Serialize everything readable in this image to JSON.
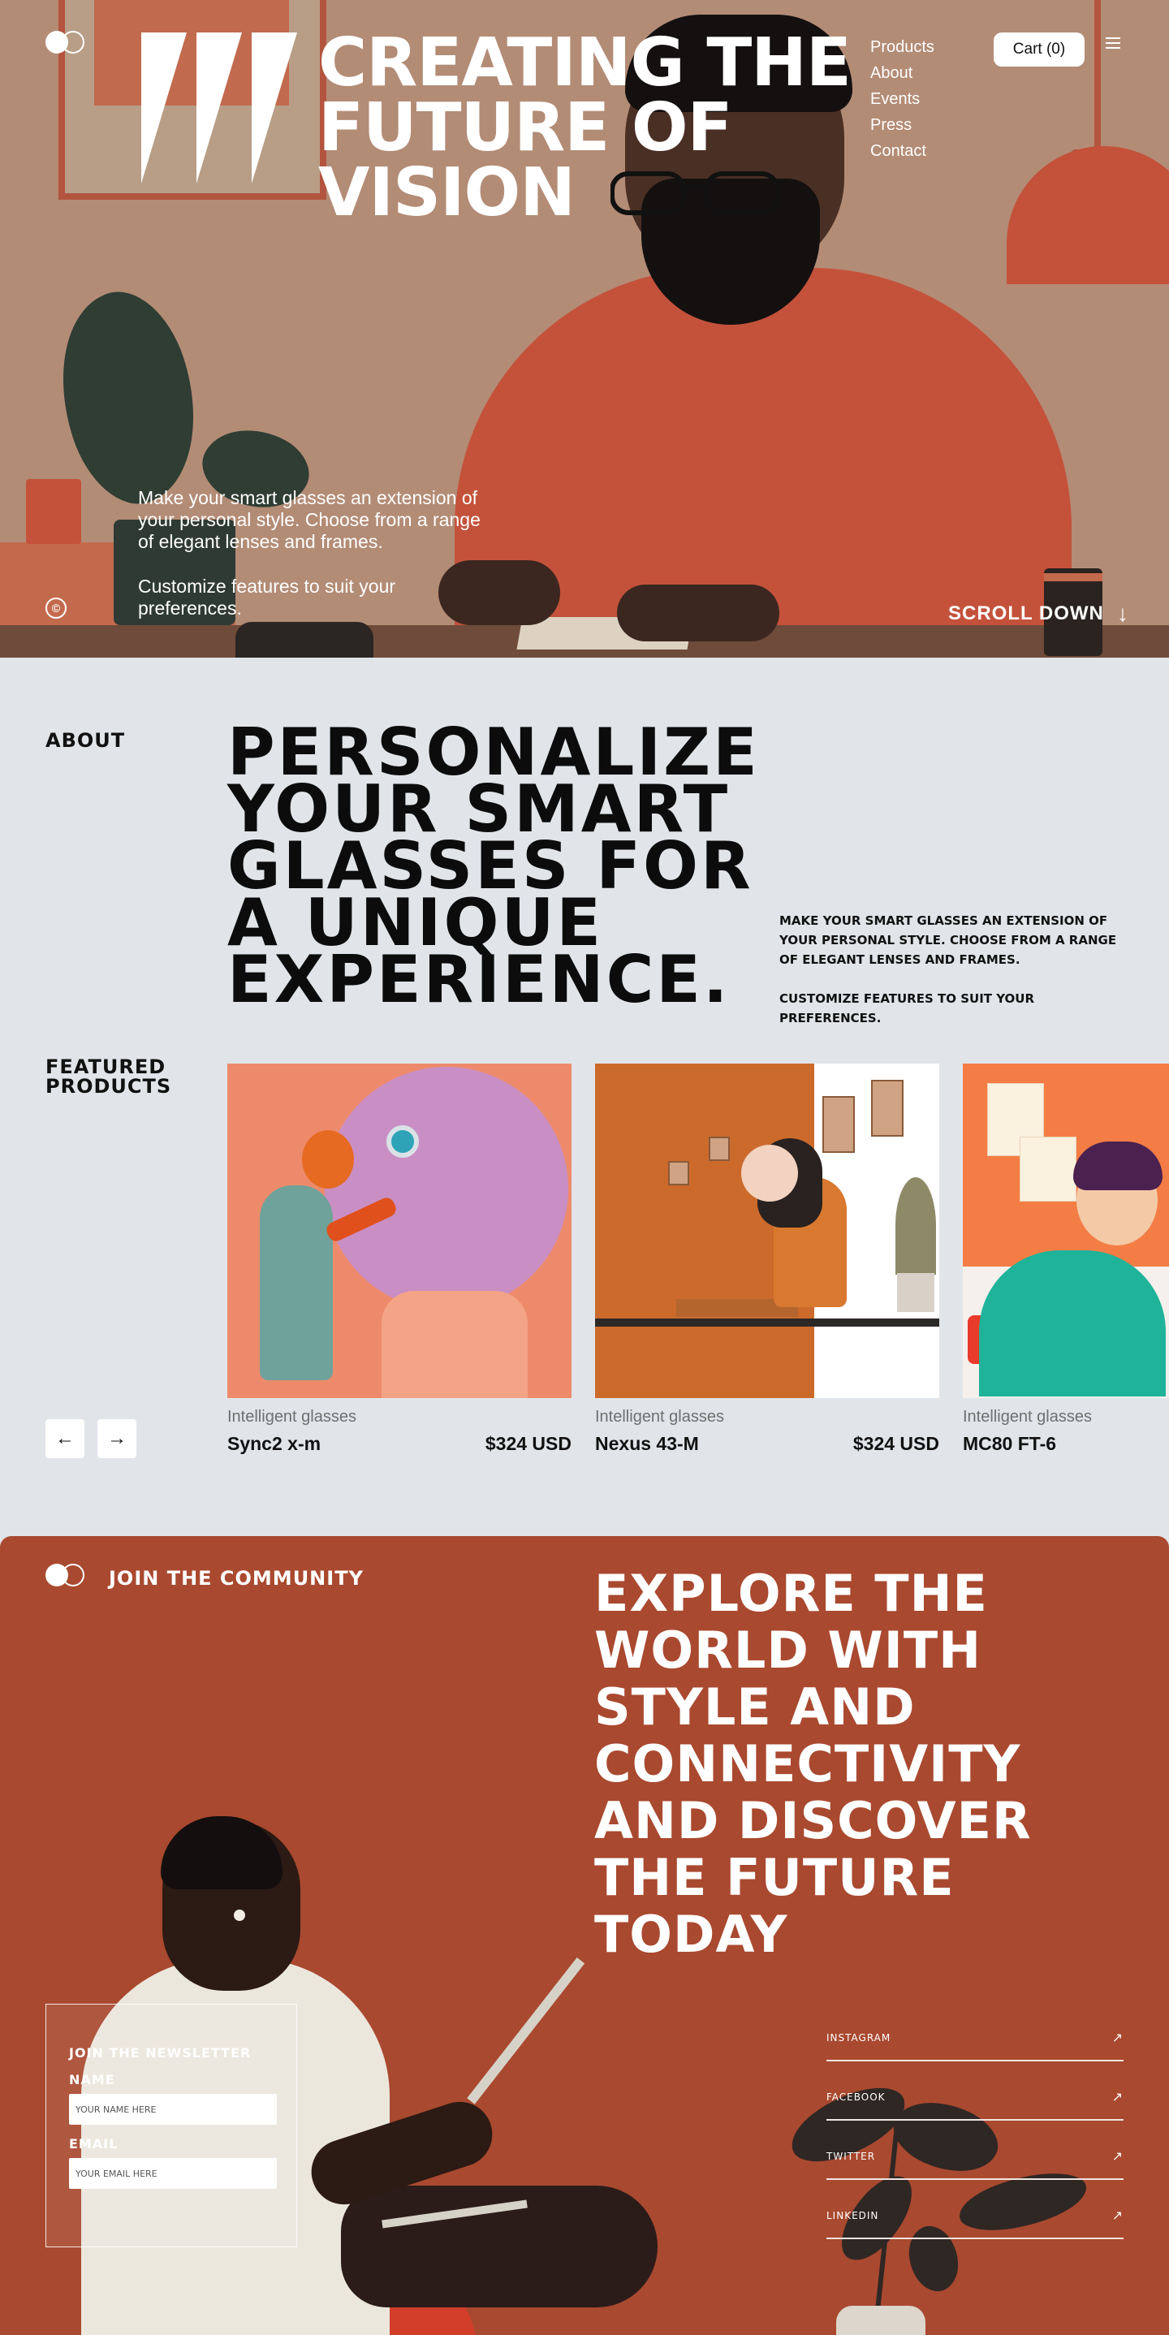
{
  "hero": {
    "title": "CREATING THE FUTURE OF VISION",
    "nav": [
      "Products",
      "About",
      "Events",
      "Press",
      "Contact"
    ],
    "cart_label": "Cart (0)",
    "paragraph1": "Make your smart glasses an extension of your personal style. Choose from a range of elegant lenses and frames.",
    "paragraph2": "Customize features to suit your preferences.",
    "copyright_symbol": "©",
    "scroll_label": "SCROLL DOWN",
    "scroll_arrow": "↓"
  },
  "about": {
    "label": "ABOUT",
    "title": "PERSONALIZE YOUR SMART GLASSES FOR A UNIQUE EXPERIENCE.",
    "side_paragraph1": "MAKE YOUR SMART GLASSES AN EXTENSION OF YOUR PERSONAL STYLE. CHOOSE FROM A RANGE OF ELEGANT LENSES AND FRAMES.",
    "side_paragraph2": "CUSTOMIZE FEATURES TO SUIT YOUR PREFERENCES."
  },
  "featured": {
    "label": "FEATURED PRODUCTS",
    "prev_icon": "←",
    "next_icon": "→",
    "products": [
      {
        "category": "Intelligent glasses",
        "name": "Sync2 x-m",
        "price": "$324 USD"
      },
      {
        "category": "Intelligent glasses",
        "name": "Nexus 43-M",
        "price": "$324 USD"
      },
      {
        "category": "Intelligent glasses",
        "name": "MC80 FT-6",
        "price": ""
      }
    ]
  },
  "community": {
    "label": "JOIN THE COMMUNITY",
    "title": "EXPLORE THE WORLD WITH STYLE AND CONNECTIVITY AND DISCOVER THE FUTURE TODAY",
    "newsletter": {
      "title": "JOIN THE NEWSLETTER",
      "name_label": "NAME",
      "name_placeholder": "YOUR NAME HERE",
      "email_label": "EMAIL",
      "email_placeholder": "YOUR EMAIL HERE"
    },
    "social": [
      {
        "label": "INSTAGRAM",
        "icon": "↗"
      },
      {
        "label": "FACEBOOK",
        "icon": "↗"
      },
      {
        "label": "TWITTER",
        "icon": "↗"
      },
      {
        "label": "LINKEDIN",
        "icon": "↗"
      }
    ]
  },
  "colors": {
    "hero_bg": "#b38c76",
    "about_bg": "#e1e5ea",
    "community_bg": "#a9492f",
    "accent_orange": "#c4523b"
  },
  "icons": {
    "logo": "toggle-logo-icon",
    "brand_mark": "three-stripes-logo-icon",
    "menu": "hamburger-menu-icon",
    "copyright": "copyright-icon",
    "scroll": "arrow-down-icon",
    "prev": "arrow-left-icon",
    "next": "arrow-right-icon",
    "external": "arrow-up-right-icon"
  }
}
